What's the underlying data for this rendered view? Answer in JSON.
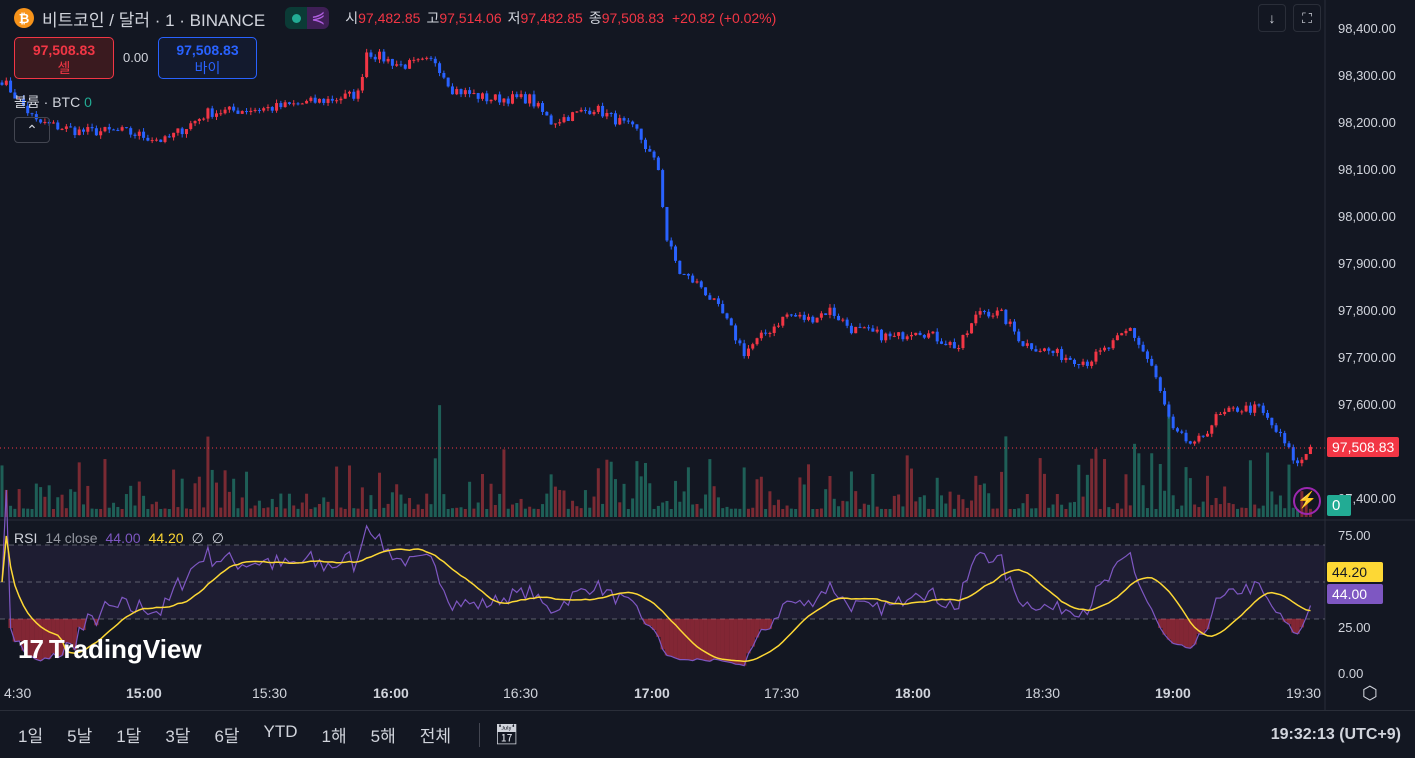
{
  "header": {
    "symbol": "비트코인 / 달러 · 1 · BINANCE",
    "coin_icon": "₿",
    "ohlc": [
      {
        "label": "시",
        "value": "97,482.85"
      },
      {
        "label": "고",
        "value": "97,514.06"
      },
      {
        "label": "저",
        "value": "97,482.85"
      },
      {
        "label": "종",
        "value": "97,508.83"
      }
    ],
    "change": "+20.82 (+0.02%)"
  },
  "trade": {
    "sell_price": "97,508.83",
    "sell_label": "셀",
    "spread": "0.00",
    "buy_price": "97,508.83",
    "buy_label": "바이"
  },
  "volume_legend": {
    "label": "볼륨 · BTC",
    "value": "0"
  },
  "rsi_legend": {
    "label": "RSI",
    "params": "14 close",
    "rsi": "44.00",
    "ma": "44.20",
    "v1": "∅",
    "v2": "∅"
  },
  "price_axis": [
    "98,400.00",
    "98,300.00",
    "98,200.00",
    "98,100.00",
    "98,000.00",
    "97,900.00",
    "97,800.00",
    "97,700.00",
    "97,600.00",
    "97,500.00",
    "97,400.00"
  ],
  "current_price_tag": "97,508.83",
  "volume_tag": "0",
  "rsi_axis": [
    "75.00",
    "50.00",
    "25.00",
    "0.00"
  ],
  "rsi_tag": "44.00",
  "rsi_ma_tag": "44.20",
  "time_axis": [
    "4:30",
    "15:00",
    "15:30",
    "16:00",
    "16:30",
    "17:00",
    "17:30",
    "18:00",
    "18:30",
    "19:00",
    "19:30"
  ],
  "ranges": [
    "1일",
    "5날",
    "1달",
    "3달",
    "6달",
    "YTD",
    "1해",
    "5해",
    "전체"
  ],
  "clock": "19:32:13 (UTC+9)",
  "logo": "TradingView",
  "colors": {
    "up": "#f23645",
    "down": "#2962ff",
    "rsi": "#7e57c2",
    "ma": "#fdd835"
  },
  "chart_data": {
    "type": "candlestick",
    "interval": "1m",
    "keypoints": [
      [
        "14:27",
        98290
      ],
      [
        "14:35",
        98200
      ],
      [
        "14:45",
        98180
      ],
      [
        "14:55",
        98180
      ],
      [
        "15:05",
        98160
      ],
      [
        "15:15",
        98220
      ],
      [
        "15:30",
        98230
      ],
      [
        "15:45",
        98250
      ],
      [
        "15:50",
        98260
      ],
      [
        "15:52",
        98350
      ],
      [
        "16:00",
        98320
      ],
      [
        "16:08",
        98330
      ],
      [
        "16:12",
        98270
      ],
      [
        "16:20",
        98250
      ],
      [
        "16:30",
        98250
      ],
      [
        "16:35",
        98200
      ],
      [
        "16:45",
        98230
      ],
      [
        "16:55",
        98180
      ],
      [
        "17:00",
        98100
      ],
      [
        "17:02",
        97950
      ],
      [
        "17:05",
        97880
      ],
      [
        "17:10",
        97850
      ],
      [
        "17:15",
        97790
      ],
      [
        "17:20",
        97710
      ],
      [
        "17:30",
        97790
      ],
      [
        "17:35",
        97780
      ],
      [
        "17:40",
        97800
      ],
      [
        "17:45",
        97760
      ],
      [
        "17:55",
        97740
      ],
      [
        "18:00",
        97760
      ],
      [
        "18:10",
        97720
      ],
      [
        "18:15",
        97800
      ],
      [
        "18:20",
        97790
      ],
      [
        "18:25",
        97730
      ],
      [
        "18:35",
        97700
      ],
      [
        "18:40",
        97690
      ],
      [
        "18:45",
        97720
      ],
      [
        "18:50",
        97760
      ],
      [
        "18:55",
        97680
      ],
      [
        "19:00",
        97540
      ],
      [
        "19:05",
        97510
      ],
      [
        "19:10",
        97570
      ],
      [
        "19:15",
        97590
      ],
      [
        "19:20",
        97590
      ],
      [
        "19:25",
        97530
      ],
      [
        "19:29",
        97470
      ],
      [
        "19:32",
        97508.83
      ]
    ],
    "ylim": [
      97380,
      98420
    ]
  }
}
